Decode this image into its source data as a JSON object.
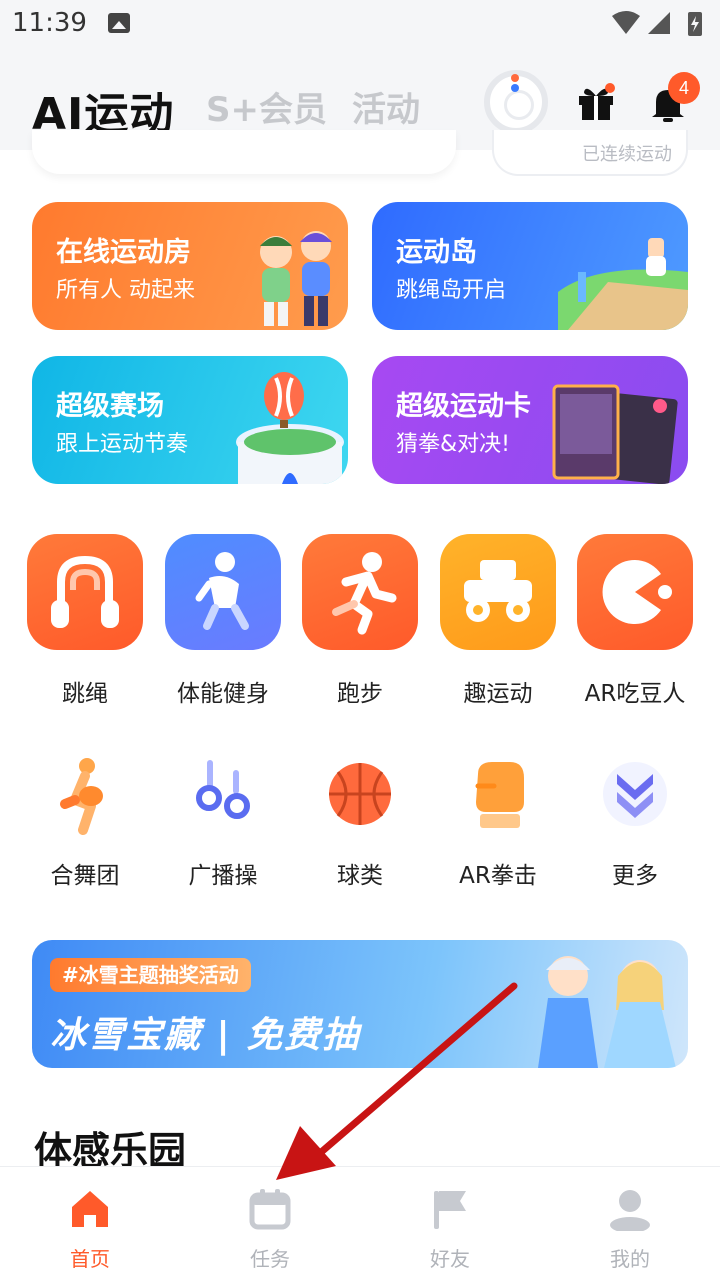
{
  "status_bar": {
    "time": "11:39"
  },
  "header": {
    "tabs": [
      {
        "label": "AI运动",
        "active": true
      },
      {
        "label": "S+会员",
        "active": false
      },
      {
        "label": "活动",
        "active": false
      }
    ],
    "notification_count": "4",
    "peek_pill_text": "已连续运动"
  },
  "feature_cards": [
    {
      "title": "在线运动房",
      "subtitle": "所有人 动起来"
    },
    {
      "title": "运动岛",
      "subtitle": "跳绳岛开启"
    },
    {
      "title": "超级赛场",
      "subtitle": "跟上运动节奏"
    },
    {
      "title": "超级运动卡",
      "subtitle": "猜拳&对决!"
    }
  ],
  "primary_apps": [
    {
      "label": "跳绳",
      "icon": "jump-rope-icon"
    },
    {
      "label": "体能健身",
      "icon": "fitness-icon"
    },
    {
      "label": "跑步",
      "icon": "running-icon"
    },
    {
      "label": "趣运动",
      "icon": "fun-sport-icon"
    },
    {
      "label": "AR吃豆人",
      "icon": "pacman-icon"
    }
  ],
  "secondary_apps": [
    {
      "label": "合舞团",
      "icon": "dance-icon"
    },
    {
      "label": "广播操",
      "icon": "rings-icon"
    },
    {
      "label": "球类",
      "icon": "basketball-icon"
    },
    {
      "label": "AR拳击",
      "icon": "boxing-glove-icon"
    },
    {
      "label": "更多",
      "icon": "more-chevron-icon"
    }
  ],
  "banner": {
    "tag": "#冰雪主题抽奖活动",
    "title": "冰雪宝藏 | 免费抽"
  },
  "section_title": "体感乐园",
  "bottom_nav": [
    {
      "label": "首页",
      "icon": "home-icon",
      "active": true
    },
    {
      "label": "任务",
      "icon": "calendar-icon",
      "active": false
    },
    {
      "label": "好友",
      "icon": "flag-icon",
      "active": false
    },
    {
      "label": "我的",
      "icon": "profile-icon",
      "active": false
    }
  ],
  "colors": {
    "accent": "#ff5a2a",
    "arrow": "#c81414",
    "inactive": "#b0b3b9"
  }
}
